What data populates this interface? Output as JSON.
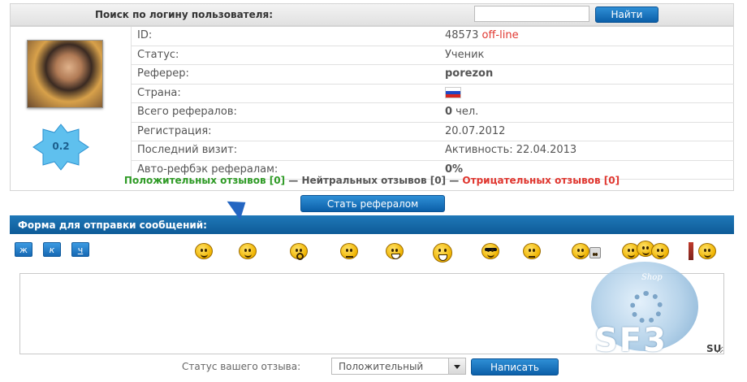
{
  "search": {
    "title": "Поиск по логину пользователя:",
    "button": "Найти",
    "value": ""
  },
  "profile": {
    "rating": "0.2",
    "rows": [
      {
        "label": "ID:",
        "value": "48573",
        "extra": "off-line"
      },
      {
        "label": "Статус:",
        "value": "Ученик"
      },
      {
        "label": "Реферер:",
        "value": "porezon"
      },
      {
        "label": "Страна:",
        "value": ""
      },
      {
        "label": "Всего рефералов:",
        "value_bold": "0",
        "value": " чел."
      },
      {
        "label": "Регистрация:",
        "value": "20.07.2012"
      },
      {
        "label": "Последний визит:",
        "value": "Активность: 22.04.2013"
      },
      {
        "label": "Авто-рефбэк рефералам:",
        "value": "0%"
      }
    ],
    "reviews": {
      "positive": "Положительных отзывов [0]",
      "sep1": " — ",
      "neutral": "Нейтральных отзывов [0]",
      "sep2": " — ",
      "negative": "Отрицательных отзывов [0]"
    }
  },
  "ref_button": "Стать рефералом",
  "message_form": {
    "title": "Форма для отправки сообщений:",
    "format_buttons": [
      "ж",
      "к",
      "ч"
    ],
    "smileys": [
      "smile-icon",
      "smile-icon",
      "surprised-icon",
      "neutral-icon",
      "grin-icon",
      "crazy-icon",
      "cool-icon",
      "meh-icon",
      "reading-icon",
      "group-icon",
      "flag-icon"
    ],
    "textarea_value": "",
    "status_label": "Статус вашего отзыва:",
    "status_selected": "Положительный",
    "send_button": "Написать"
  },
  "watermark": {
    "top": "Shop",
    "big": "SF3",
    "suffix": "SU"
  },
  "colors": {
    "accent": "#0e5b98",
    "red": "#e0362f",
    "green": "#2f9b26",
    "orange": "#e07a17"
  }
}
